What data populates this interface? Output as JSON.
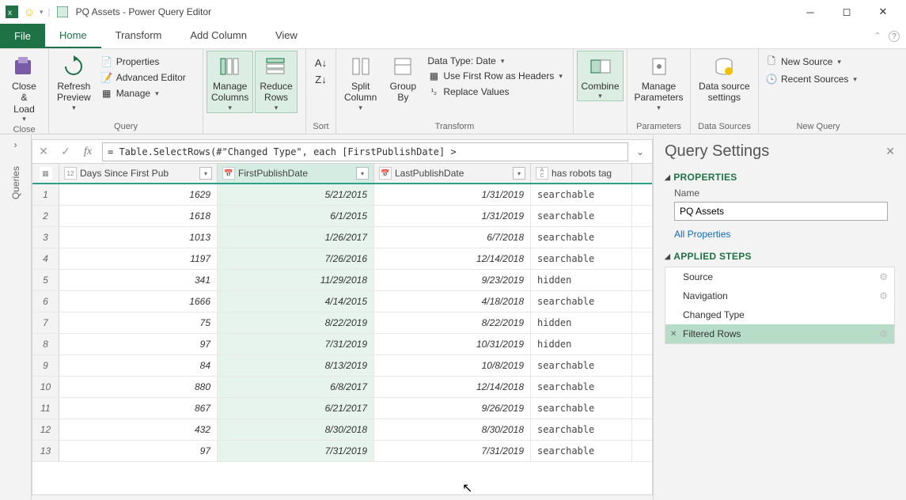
{
  "window": {
    "title": "PQ Assets - Power Query Editor"
  },
  "menu": {
    "file": "File",
    "tabs": [
      "Home",
      "Transform",
      "Add Column",
      "View"
    ]
  },
  "ribbon": {
    "close_load": "Close &\nLoad",
    "close_group": "Close",
    "refresh": "Refresh\nPreview",
    "properties": "Properties",
    "advanced": "Advanced Editor",
    "manage": "Manage",
    "query_group": "Query",
    "manage_cols": "Manage\nColumns",
    "reduce_rows": "Reduce\nRows",
    "sort_group": "Sort",
    "split": "Split\nColumn",
    "group": "Group\nBy",
    "datatype": "Data Type: Date",
    "firstrow": "Use First Row as Headers",
    "replace": "Replace Values",
    "transform_group": "Transform",
    "combine": "Combine",
    "params": "Manage\nParameters",
    "params_group": "Parameters",
    "ds_settings": "Data source\nsettings",
    "ds_group": "Data Sources",
    "new_source": "New Source",
    "recent_sources": "Recent Sources",
    "new_query_group": "New Query"
  },
  "leftrail": {
    "label": "Queries"
  },
  "formula": {
    "value": "= Table.SelectRows(#\"Changed Type\", each [FirstPublishDate] >"
  },
  "columns": {
    "c0_icon": "12",
    "c1": "Days Since First Pub",
    "c2": "FirstPublishDate",
    "c3": "LastPublishDate",
    "c4": "has robots tag",
    "c2_type": "📅",
    "c3_type": "📅",
    "c4_type": "ABC"
  },
  "rows": [
    {
      "n": "1",
      "days": "1629",
      "first": "5/21/2015",
      "last": "1/31/2019",
      "tag": "searchable"
    },
    {
      "n": "2",
      "days": "1618",
      "first": "6/1/2015",
      "last": "1/31/2019",
      "tag": "searchable"
    },
    {
      "n": "3",
      "days": "1013",
      "first": "1/26/2017",
      "last": "6/7/2018",
      "tag": "searchable"
    },
    {
      "n": "4",
      "days": "1197",
      "first": "7/26/2016",
      "last": "12/14/2018",
      "tag": "searchable"
    },
    {
      "n": "5",
      "days": "341",
      "first": "11/29/2018",
      "last": "9/23/2019",
      "tag": "hidden"
    },
    {
      "n": "6",
      "days": "1666",
      "first": "4/14/2015",
      "last": "4/18/2018",
      "tag": "searchable"
    },
    {
      "n": "7",
      "days": "75",
      "first": "8/22/2019",
      "last": "8/22/2019",
      "tag": "hidden"
    },
    {
      "n": "8",
      "days": "97",
      "first": "7/31/2019",
      "last": "10/31/2019",
      "tag": "hidden"
    },
    {
      "n": "9",
      "days": "84",
      "first": "8/13/2019",
      "last": "10/8/2019",
      "tag": "searchable"
    },
    {
      "n": "10",
      "days": "880",
      "first": "6/8/2017",
      "last": "12/14/2018",
      "tag": "searchable"
    },
    {
      "n": "11",
      "days": "867",
      "first": "6/21/2017",
      "last": "9/26/2019",
      "tag": "searchable"
    },
    {
      "n": "12",
      "days": "432",
      "first": "8/30/2018",
      "last": "8/30/2018",
      "tag": "searchable"
    },
    {
      "n": "13",
      "days": "97",
      "first": "7/31/2019",
      "last": "7/31/2019",
      "tag": "searchable"
    }
  ],
  "settings": {
    "title": "Query Settings",
    "properties": "PROPERTIES",
    "name_label": "Name",
    "name_value": "PQ Assets",
    "all_props": "All Properties",
    "applied": "APPLIED STEPS",
    "steps": [
      "Source",
      "Navigation",
      "Changed Type",
      "Filtered Rows"
    ]
  }
}
